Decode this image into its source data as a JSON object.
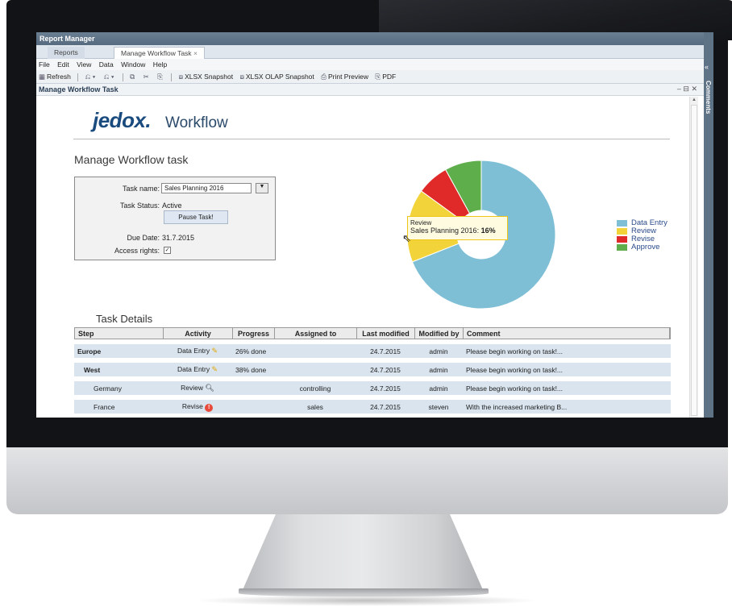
{
  "window": {
    "title": "Report Manager"
  },
  "tabs": [
    {
      "label": "Reports"
    },
    {
      "label": "Manage Workflow Task",
      "close": "×"
    }
  ],
  "menu": [
    "File",
    "Edit",
    "View",
    "Data",
    "Window",
    "Help"
  ],
  "toolbar": {
    "refresh": "Refresh",
    "xlsx_snapshot": "XLSX Snapshot",
    "xlsx_olap_snapshot": "XLSX OLAP Snapshot",
    "print_preview": "Print Preview",
    "pdf": "PDF"
  },
  "panel": {
    "title": "Manage Workflow Task",
    "controls": "– ⊟ ✕"
  },
  "side_strip": {
    "label": "Comments",
    "icon": "«"
  },
  "logo": {
    "brand": "jedox.",
    "product": "Workflow"
  },
  "page": {
    "title": "Manage Workflow task"
  },
  "form": {
    "task_name_label": "Task name:",
    "task_name_value": "Sales Planning 2016",
    "task_status_label": "Task Status:",
    "task_status_value": "Active",
    "pause_button": "Pause Task!",
    "due_date_label": "Due Date:",
    "due_date_value": "31.7.2015",
    "access_rights_label": "Access rights:",
    "access_rights_checked": "✓"
  },
  "chart_data": {
    "type": "pie",
    "donut": true,
    "series": [
      {
        "name": "Data Entry",
        "value": 69,
        "color": "#7fbfd6"
      },
      {
        "name": "Review",
        "value": 16,
        "color": "#f2d43a"
      },
      {
        "name": "Revise",
        "value": 7,
        "color": "#e02a2a"
      },
      {
        "name": "Approve",
        "value": 8,
        "color": "#5fae4c"
      }
    ],
    "legend_position": "right"
  },
  "tooltip": {
    "line1": "Review",
    "line2_label": "Sales Planning 2016:",
    "line2_value": "16%"
  },
  "details": {
    "title": "Task Details",
    "columns": [
      "Step",
      "Activity",
      "Progress",
      "Assigned to",
      "Last modified",
      "Modified by",
      "Comment"
    ],
    "rows": [
      {
        "step": "Europe",
        "activity": "Data Entry",
        "icon": "pencil-icon",
        "progress": "26% done",
        "assigned": "",
        "modified": "24.7.2015",
        "by": "admin",
        "comment": "Please begin working on task!..."
      },
      {
        "step": "West",
        "activity": "Data Entry",
        "icon": "pencil-icon",
        "progress": "38% done",
        "assigned": "",
        "modified": "24.7.2015",
        "by": "admin",
        "comment": "Please begin working on task!..."
      },
      {
        "step": "Germany",
        "activity": "Review",
        "icon": "magnifier-icon",
        "progress": "",
        "assigned": "controlling",
        "modified": "24.7.2015",
        "by": "admin",
        "comment": "Please begin working on task!..."
      },
      {
        "step": "France",
        "activity": "Revise",
        "icon": "warning-icon",
        "progress": "",
        "assigned": "sales",
        "modified": "24.7.2015",
        "by": "steven",
        "comment": "With the increased marketing B..."
      }
    ]
  }
}
